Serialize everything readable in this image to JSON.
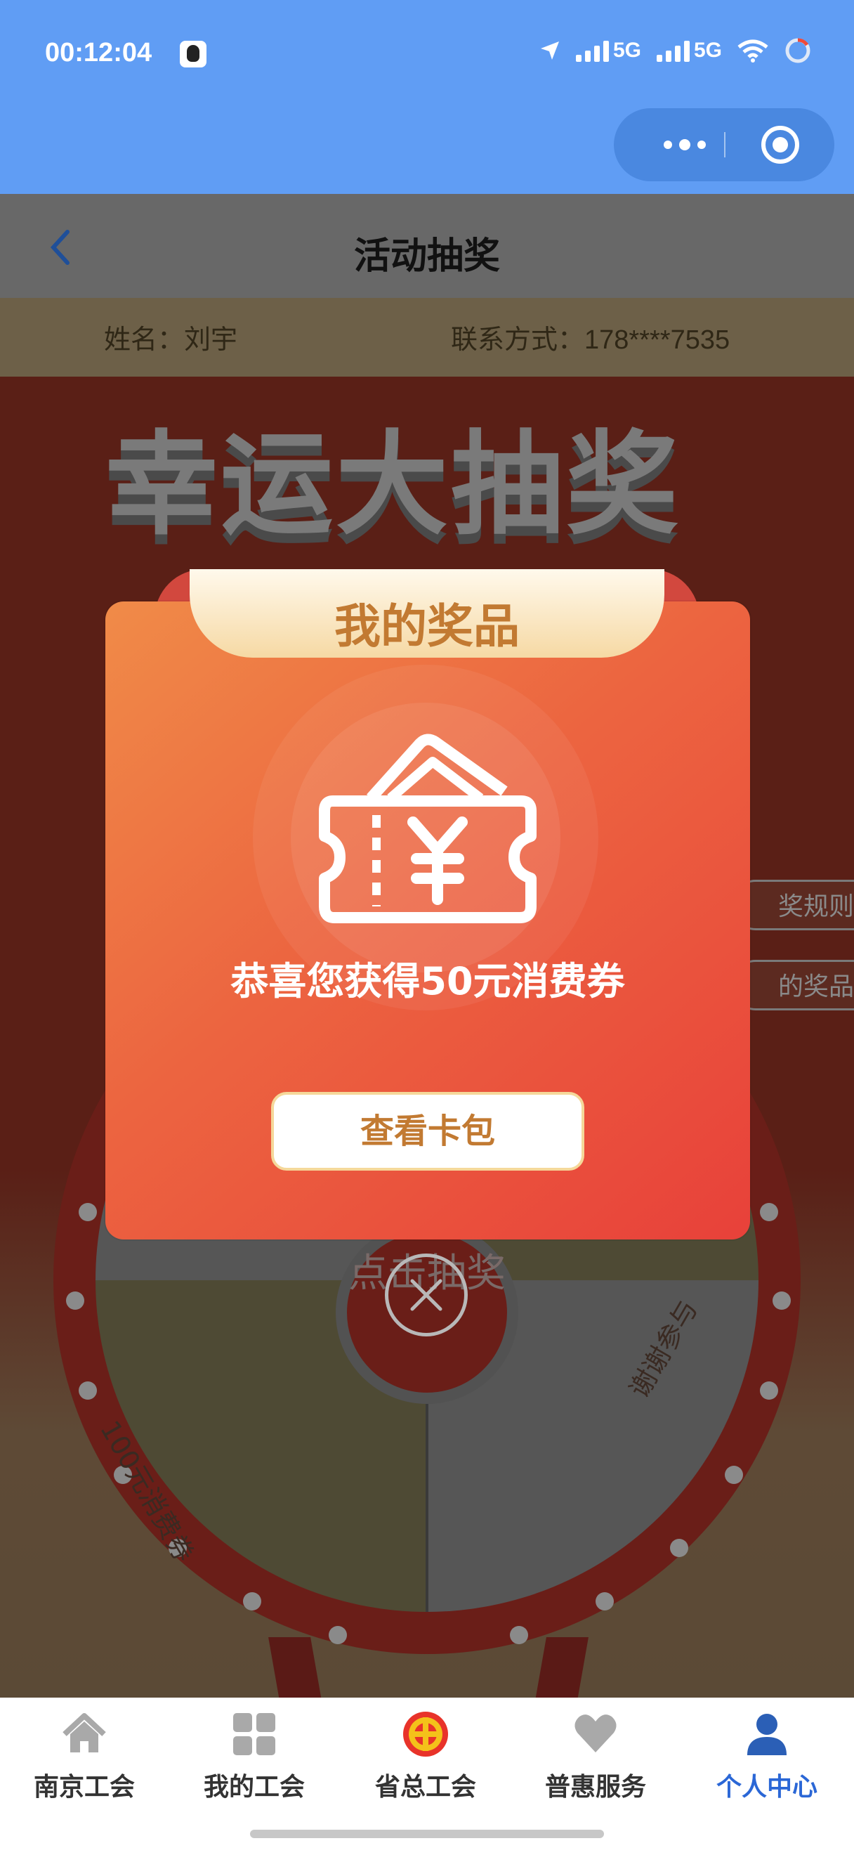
{
  "status_bar": {
    "time": "00:12:04",
    "network_1": "5G",
    "network_2": "5G"
  },
  "header": {
    "title": "活动抽奖"
  },
  "user": {
    "name_label": "姓名：",
    "name": "刘宇",
    "contact_label": "联系方式：",
    "contact": "178****7535"
  },
  "background": {
    "big_title": "幸运大抽奖",
    "side_tabs": [
      "奖规则",
      "的奖品"
    ],
    "wheel_center": "点击抽奖",
    "segment_left": "100元消费券",
    "segment_right": "谢谢参与"
  },
  "modal": {
    "title": "我的奖品",
    "message": "恭喜您获得50元消费券",
    "button": "查看卡包",
    "icon": "coupon-wallet-icon"
  },
  "tabbar": {
    "items": [
      {
        "label": "南京工会",
        "icon": "home-icon"
      },
      {
        "label": "我的工会",
        "icon": "grid-icon"
      },
      {
        "label": "省总工会",
        "icon": "union-emblem-icon"
      },
      {
        "label": "普惠服务",
        "icon": "heart-icon"
      },
      {
        "label": "个人中心",
        "icon": "person-icon",
        "active": true
      }
    ]
  },
  "colors": {
    "accent": "#2b67d6",
    "status_bar": "#609df4",
    "modal_gold": "#c27a32"
  }
}
